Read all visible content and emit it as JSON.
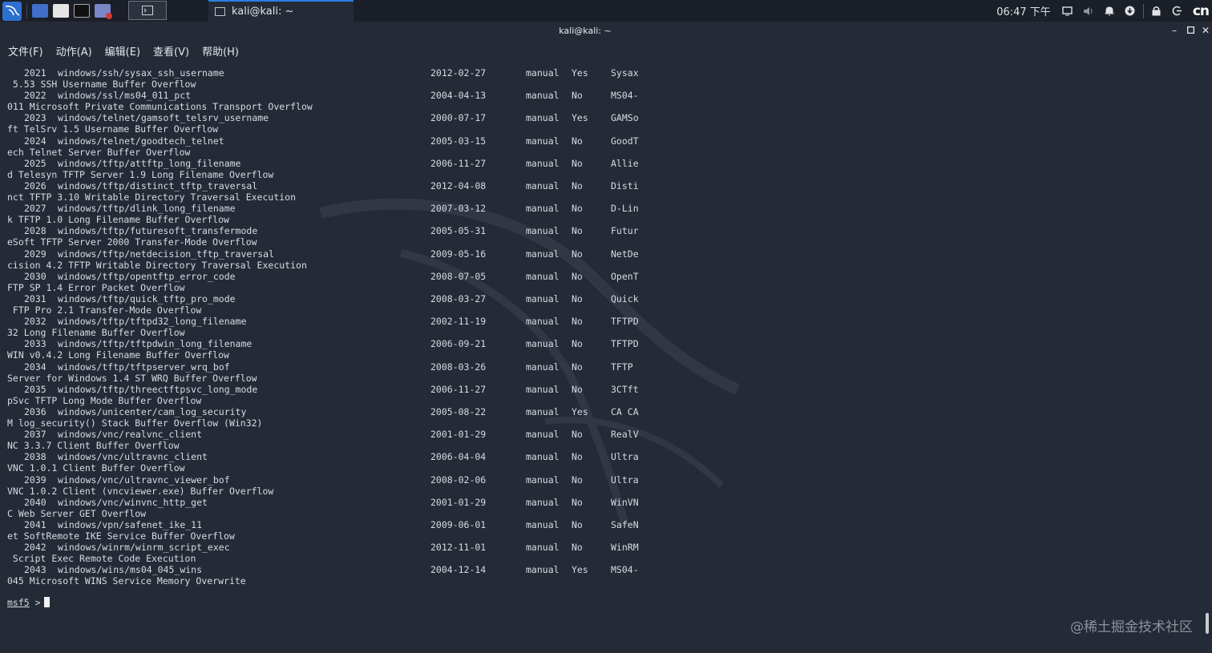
{
  "panel": {
    "task_title": "kali@kali: ~",
    "clock": "06:47 下午",
    "badge": "cn",
    "icons": [
      "kali-menu-icon",
      "desktop-icon",
      "file-manager-icon",
      "terminal-icon",
      "app-icon"
    ]
  },
  "window": {
    "title": "kali@kali: ~"
  },
  "menu": [
    "文件(F)",
    "动作(A)",
    "编辑(E)",
    "查看(V)",
    "帮助(H)"
  ],
  "rows": [
    {
      "num": "2021",
      "path": "windows/ssh/sysax_ssh_username",
      "date": "2012-02-27",
      "rank": "manual",
      "check": "Yes",
      "desc": "Sysax",
      "cont": " 5.53 SSH Username Buffer Overflow"
    },
    {
      "num": "2022",
      "path": "windows/ssl/ms04_011_pct",
      "date": "2004-04-13",
      "rank": "manual",
      "check": "No",
      "desc": "MS04-",
      "cont": "011 Microsoft Private Communications Transport Overflow"
    },
    {
      "num": "2023",
      "path": "windows/telnet/gamsoft_telsrv_username",
      "date": "2000-07-17",
      "rank": "manual",
      "check": "Yes",
      "desc": "GAMSo",
      "cont": "ft TelSrv 1.5 Username Buffer Overflow"
    },
    {
      "num": "2024",
      "path": "windows/telnet/goodtech_telnet",
      "date": "2005-03-15",
      "rank": "manual",
      "check": "No",
      "desc": "GoodT",
      "cont": "ech Telnet Server Buffer Overflow"
    },
    {
      "num": "2025",
      "path": "windows/tftp/attftp_long_filename",
      "date": "2006-11-27",
      "rank": "manual",
      "check": "No",
      "desc": "Allie",
      "cont": "d Telesyn TFTP Server 1.9 Long Filename Overflow"
    },
    {
      "num": "2026",
      "path": "windows/tftp/distinct_tftp_traversal",
      "date": "2012-04-08",
      "rank": "manual",
      "check": "No",
      "desc": "Disti",
      "cont": "nct TFTP 3.10 Writable Directory Traversal Execution"
    },
    {
      "num": "2027",
      "path": "windows/tftp/dlink_long_filename",
      "date": "2007-03-12",
      "rank": "manual",
      "check": "No",
      "desc": "D-Lin",
      "cont": "k TFTP 1.0 Long Filename Buffer Overflow"
    },
    {
      "num": "2028",
      "path": "windows/tftp/futuresoft_transfermode",
      "date": "2005-05-31",
      "rank": "manual",
      "check": "No",
      "desc": "Futur",
      "cont": "eSoft TFTP Server 2000 Transfer-Mode Overflow"
    },
    {
      "num": "2029",
      "path": "windows/tftp/netdecision_tftp_traversal",
      "date": "2009-05-16",
      "rank": "manual",
      "check": "No",
      "desc": "NetDe",
      "cont": "cision 4.2 TFTP Writable Directory Traversal Execution"
    },
    {
      "num": "2030",
      "path": "windows/tftp/opentftp_error_code",
      "date": "2008-07-05",
      "rank": "manual",
      "check": "No",
      "desc": "OpenT",
      "cont": "FTP SP 1.4 Error Packet Overflow"
    },
    {
      "num": "2031",
      "path": "windows/tftp/quick_tftp_pro_mode",
      "date": "2008-03-27",
      "rank": "manual",
      "check": "No",
      "desc": "Quick",
      "cont": " FTP Pro 2.1 Transfer-Mode Overflow"
    },
    {
      "num": "2032",
      "path": "windows/tftp/tftpd32_long_filename",
      "date": "2002-11-19",
      "rank": "manual",
      "check": "No",
      "desc": "TFTPD",
      "cont": "32 Long Filename Buffer Overflow"
    },
    {
      "num": "2033",
      "path": "windows/tftp/tftpdwin_long_filename",
      "date": "2006-09-21",
      "rank": "manual",
      "check": "No",
      "desc": "TFTPD",
      "cont": "WIN v0.4.2 Long Filename Buffer Overflow"
    },
    {
      "num": "2034",
      "path": "windows/tftp/tftpserver_wrq_bof",
      "date": "2008-03-26",
      "rank": "manual",
      "check": "No",
      "desc": "TFTP ",
      "cont": "Server for Windows 1.4 ST WRQ Buffer Overflow"
    },
    {
      "num": "2035",
      "path": "windows/tftp/threectftpsvc_long_mode",
      "date": "2006-11-27",
      "rank": "manual",
      "check": "No",
      "desc": "3CTft",
      "cont": "pSvc TFTP Long Mode Buffer Overflow"
    },
    {
      "num": "2036",
      "path": "windows/unicenter/cam_log_security",
      "date": "2005-08-22",
      "rank": "manual",
      "check": "Yes",
      "desc": "CA CA",
      "cont": "M log_security() Stack Buffer Overflow (Win32)"
    },
    {
      "num": "2037",
      "path": "windows/vnc/realvnc_client",
      "date": "2001-01-29",
      "rank": "manual",
      "check": "No",
      "desc": "RealV",
      "cont": "NC 3.3.7 Client Buffer Overflow"
    },
    {
      "num": "2038",
      "path": "windows/vnc/ultravnc_client",
      "date": "2006-04-04",
      "rank": "manual",
      "check": "No",
      "desc": "Ultra",
      "cont": "VNC 1.0.1 Client Buffer Overflow"
    },
    {
      "num": "2039",
      "path": "windows/vnc/ultravnc_viewer_bof",
      "date": "2008-02-06",
      "rank": "manual",
      "check": "No",
      "desc": "Ultra",
      "cont": "VNC 1.0.2 Client (vncviewer.exe) Buffer Overflow"
    },
    {
      "num": "2040",
      "path": "windows/vnc/winvnc_http_get",
      "date": "2001-01-29",
      "rank": "manual",
      "check": "No",
      "desc": "WinVN",
      "cont": "C Web Server GET Overflow"
    },
    {
      "num": "2041",
      "path": "windows/vpn/safenet_ike_11",
      "date": "2009-06-01",
      "rank": "manual",
      "check": "No",
      "desc": "SafeN",
      "cont": "et SoftRemote IKE Service Buffer Overflow"
    },
    {
      "num": "2042",
      "path": "windows/winrm/winrm_script_exec",
      "date": "2012-11-01",
      "rank": "manual",
      "check": "No",
      "desc": "WinRM",
      "cont": " Script Exec Remote Code Execution"
    },
    {
      "num": "2043",
      "path": "windows/wins/ms04_045_wins",
      "date": "2004-12-14",
      "rank": "manual",
      "check": "Yes",
      "desc": "MS04-",
      "cont": "045 Microsoft WINS Service Memory Overwrite"
    }
  ],
  "prompt": {
    "name": "msf5",
    "symbol": ">"
  },
  "watermark": "@稀土掘金技术社区"
}
